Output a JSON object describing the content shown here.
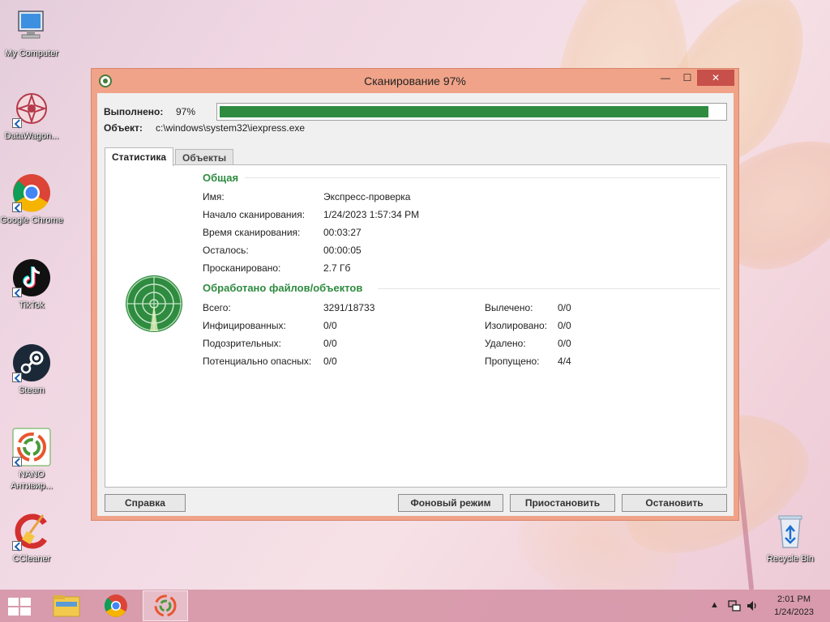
{
  "desktop": {
    "icons": [
      {
        "label": "My Computer"
      },
      {
        "label": "DataWagon..."
      },
      {
        "label": "Google Chrome"
      },
      {
        "label": "TikTok"
      },
      {
        "label": "Steam"
      },
      {
        "label": "NANO Антивир..."
      },
      {
        "label": "CCleaner"
      },
      {
        "label": "Recycle Bin"
      }
    ]
  },
  "window": {
    "title": "Сканирование 97%",
    "controls": {
      "minimize": "—",
      "maximize": "☐",
      "close": "✕"
    },
    "progress": {
      "label": "Выполнено:",
      "percent_text": "97%",
      "value": 0.97
    },
    "object": {
      "label": "Объект:",
      "value": "c:\\windows\\system32\\iexpress.exe"
    },
    "tabs": [
      {
        "label": "Статистика"
      },
      {
        "label": "Объекты"
      }
    ],
    "general": {
      "title": "Общая",
      "rows": [
        {
          "k": "Имя:",
          "v": "Экспресс-проверка"
        },
        {
          "k": "Начало сканирования:",
          "v": "1/24/2023 1:57:34 PM"
        },
        {
          "k": "Время сканирования:",
          "v": "00:03:27"
        },
        {
          "k": "Осталось:",
          "v": "00:00:05"
        },
        {
          "k": "Просканировано:",
          "v": "2.7 Гб"
        }
      ]
    },
    "processed": {
      "title": "Обработано файлов/объектов",
      "left": [
        {
          "k": "Всего:",
          "v": "3291/18733"
        },
        {
          "k": "Инфицированных:",
          "v": "0/0"
        },
        {
          "k": "Подозрительных:",
          "v": "0/0"
        },
        {
          "k": "Потенциально опасных:",
          "v": "0/0"
        }
      ],
      "right": [
        {
          "k": "Вылечено:",
          "v": "0/0"
        },
        {
          "k": "Изолировано:",
          "v": "0/0"
        },
        {
          "k": "Удалено:",
          "v": "0/0"
        },
        {
          "k": "Пропущено:",
          "v": "4/4"
        }
      ]
    },
    "buttons": {
      "help": "Справка",
      "background": "Фоновый режим",
      "pause": "Приостановить",
      "stop": "Остановить"
    }
  },
  "taskbar": {
    "time": "2:01 PM",
    "date": "1/24/2023"
  },
  "colors": {
    "accent_green": "#2e8b40",
    "close_red": "#c7504a",
    "window_frame": "#f0a388"
  }
}
